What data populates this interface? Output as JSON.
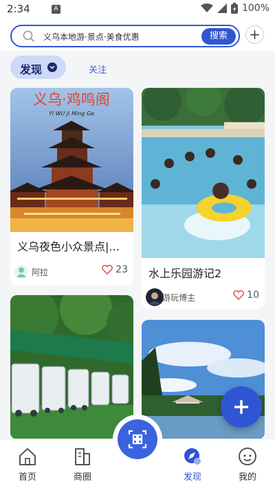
{
  "status": {
    "time": "2:34",
    "notification_glyph": "A",
    "battery": "100%"
  },
  "search": {
    "placeholder": "义乌本地游·景点·美食优惠",
    "button_label": "搜索",
    "add_label": "+"
  },
  "tabs": {
    "active": "发现",
    "other": "关注"
  },
  "feed": [
    {
      "title": "义乌夜色小众景点|...",
      "author": "阿拉",
      "likes": "23",
      "image": "yiwu-tower-photo",
      "image_caption": "义乌·鸡鸣阁",
      "image_subcaption": "YI WU  Ji Ming Ge"
    },
    {
      "title": "水上乐园游记2",
      "author": "游玩博主",
      "likes": "10",
      "image": "water-park-photo"
    },
    {
      "title": "",
      "author": "",
      "likes": "",
      "image": "shuttle-carts-photo"
    },
    {
      "title": "",
      "author": "",
      "likes": "",
      "image": "lake-pavilion-photo"
    }
  ],
  "fab": {
    "icon": "plus-icon",
    "label": "+"
  },
  "bottom_nav": [
    {
      "label": "首页",
      "icon": "home-icon"
    },
    {
      "label": "商圈",
      "icon": "buildings-icon"
    },
    {
      "label": "发现",
      "icon": "discover-icon",
      "active": true
    },
    {
      "label": "我的",
      "icon": "profile-icon"
    }
  ],
  "scan": {
    "icon": "scan-icon"
  },
  "colors": {
    "accent": "#2f55d4",
    "tab_bg": "#cdd9f7",
    "like_red": "#e04b4b"
  }
}
